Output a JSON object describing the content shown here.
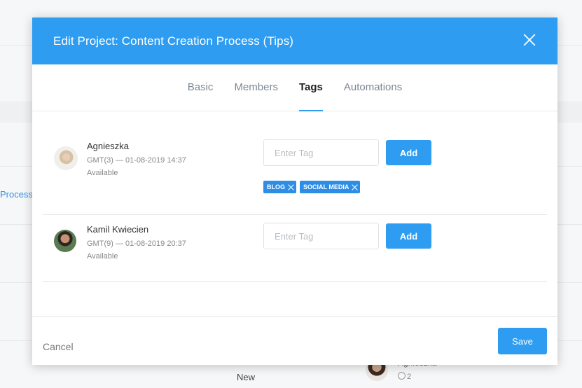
{
  "background": {
    "link_text": "Process (",
    "status_text": "New",
    "member_name": "Agnieszka",
    "member_count": "2"
  },
  "modal": {
    "title": "Edit Project: Content Creation Process (Tips)",
    "tabs": [
      {
        "label": "Basic",
        "active": false
      },
      {
        "label": "Members",
        "active": false
      },
      {
        "label": "Tags",
        "active": true
      },
      {
        "label": "Automations",
        "active": false
      }
    ],
    "members": [
      {
        "name": "Agnieszka",
        "timezone_time": "GMT(3) — 01-08-2019 14:37",
        "status": "Available",
        "input_placeholder": "Enter Tag",
        "add_label": "Add",
        "tags": [
          "BLOG",
          "SOCIAL MEDIA"
        ]
      },
      {
        "name": "Kamil Kwiecien",
        "timezone_time": "GMT(9) — 01-08-2019 20:37",
        "status": "Available",
        "input_placeholder": "Enter Tag",
        "add_label": "Add",
        "tags": []
      }
    ],
    "footer": {
      "cancel_label": "Cancel",
      "save_label": "Save"
    },
    "colors": {
      "accent": "#2e9cf0"
    }
  }
}
